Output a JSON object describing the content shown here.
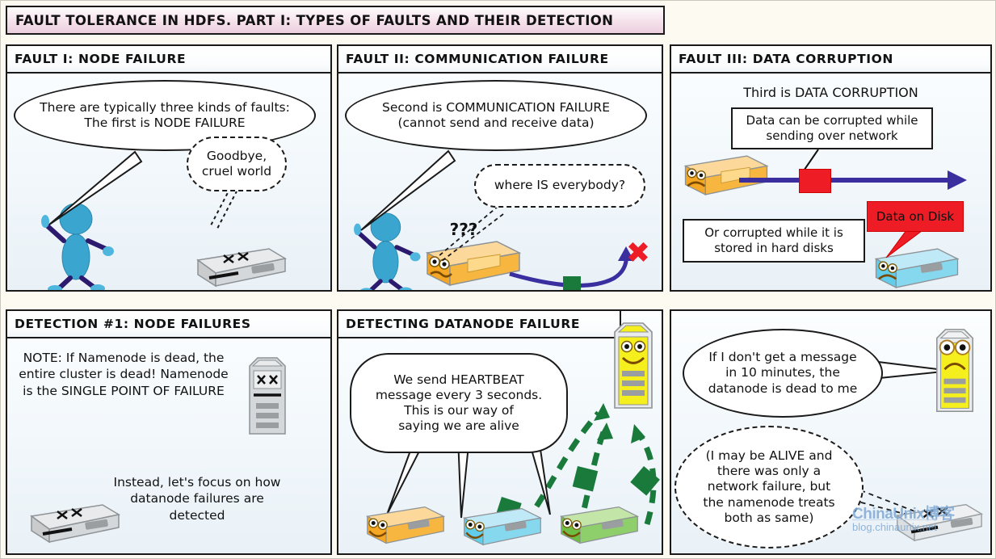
{
  "poster": {
    "title": "FAULT TOLERANCE IN HDFS. PART I: TYPES OF FAULTS AND THEIR DETECTION",
    "colors": {
      "title_bar_pink": "#eccede",
      "panel_border": "#1a1a1a",
      "page_background": "#fdfaf2",
      "panel_background": "#f4f9fc",
      "heartbeat_green": "#1a7a3c",
      "network_blue": "#3b2fa0",
      "corruption_red": "#ee1c24",
      "namenode_yellow": "#f6ef1e",
      "datanode_orange": "#f5a623",
      "datanode_cyan": "#62cdea",
      "datanode_green": "#6cbe45",
      "dead_node_gray": "#c9cbcd",
      "stick_figure_blue": "#3aa6d0",
      "watermark_blue": "#7fa9d4"
    }
  },
  "panels": [
    {
      "id": "fault-1",
      "header": "FAULT I: NODE FAILURE",
      "bubbles": [
        {
          "name": "narrator-bubble",
          "lines": [
            "There are typically three kinds of faults:",
            "The first is NODE FAILURE"
          ]
        },
        {
          "name": "dying-node-bubble",
          "lines": [
            "Goodbye,",
            "cruel world"
          ]
        }
      ],
      "figures": [
        {
          "name": "narrator-stick-figure",
          "kind": "stick-figure",
          "color": "#3aa6d0"
        },
        {
          "name": "dead-datanode",
          "kind": "server-dead",
          "color": "#c9cbcd",
          "face": "dead"
        }
      ]
    },
    {
      "id": "fault-2",
      "header": "FAULT II: COMMUNICATION FAILURE",
      "bubbles": [
        {
          "name": "narrator-bubble",
          "lines": [
            "Second is COMMUNICATION FAILURE",
            "(cannot send and receive data)"
          ]
        },
        {
          "name": "isolated-node-bubble",
          "lines": [
            "where IS everybody?"
          ]
        }
      ],
      "figures": [
        {
          "name": "narrator-stick-figure",
          "kind": "stick-figure",
          "color": "#3aa6d0"
        },
        {
          "name": "confused-datanode",
          "kind": "server",
          "color": "#f5a623",
          "face": "confused",
          "thought": "???"
        },
        {
          "name": "broken-link-arrow",
          "kind": "arrow",
          "color": "#3b2fa0",
          "marker": "green-square"
        },
        {
          "name": "failure-cross",
          "kind": "cross",
          "color": "#ee1c24",
          "label": "✖"
        }
      ]
    },
    {
      "id": "fault-3",
      "header": "FAULT III: DATA CORRUPTION",
      "caption": "Third is DATA CORRUPTION",
      "bubbles": [
        {
          "name": "network-corruption-box",
          "lines": [
            "Data can be corrupted while",
            "sending over network"
          ]
        },
        {
          "name": "disk-corruption-box",
          "lines": [
            "Or corrupted while it is",
            "stored in hard disks"
          ]
        }
      ],
      "callouts": [
        {
          "name": "data-on-disk-callout",
          "label": "Data on Disk",
          "color": "#ee1c24"
        }
      ],
      "figures": [
        {
          "name": "sending-datanode",
          "kind": "server",
          "color": "#f5a623",
          "face": "sad"
        },
        {
          "name": "corrupt-packet-block",
          "kind": "block",
          "color": "#ee1c24"
        },
        {
          "name": "network-arrow",
          "kind": "arrow",
          "color": "#3b2fa0"
        },
        {
          "name": "disk-datanode",
          "kind": "server",
          "color": "#62cdea",
          "face": "sad"
        }
      ]
    },
    {
      "id": "detection-1",
      "header": "DETECTION #1: NODE FAILURES",
      "notes": [
        {
          "name": "namenode-spof-note",
          "lines": [
            "NOTE:",
            "If Namenode is dead,",
            "the entire cluster is dead!",
            "Namenode is the SINGLE",
            "POINT OF FAILURE"
          ]
        },
        {
          "name": "focus-note",
          "lines": [
            "Instead, let's focus on",
            "how datanode failures",
            "are detected"
          ]
        }
      ],
      "figures": [
        {
          "name": "dead-namenode-tower",
          "kind": "tower-dead",
          "color": "#c9cbcd",
          "face": "dead"
        },
        {
          "name": "dead-datanode",
          "kind": "server-dead",
          "color": "#c9cbcd",
          "face": "dead"
        }
      ]
    },
    {
      "id": "detection-datanode",
      "header": "DETECTING DATANODE FAILURE",
      "bubbles": [
        {
          "name": "heartbeat-bubble",
          "lines": [
            "We send HEARTBEAT",
            "message every 3 seconds.",
            "This is our way of",
            "saying we are alive"
          ]
        }
      ],
      "figures": [
        {
          "name": "namenode-tower-happy",
          "kind": "tower",
          "color": "#f6ef1e",
          "face": "happy"
        },
        {
          "name": "datanode-orange",
          "kind": "server",
          "color": "#f5a623",
          "face": "happy"
        },
        {
          "name": "datanode-cyan",
          "kind": "server",
          "color": "#62cdea",
          "face": "happy"
        },
        {
          "name": "datanode-green",
          "kind": "server",
          "color": "#6cbe45",
          "face": "happy"
        },
        {
          "name": "heartbeat-arrow-1",
          "kind": "dashed-arrow",
          "color": "#1a7a3c"
        },
        {
          "name": "heartbeat-arrow-2",
          "kind": "dashed-arrow",
          "color": "#1a7a3c"
        },
        {
          "name": "heartbeat-arrow-3",
          "kind": "dashed-arrow",
          "color": "#1a7a3c"
        }
      ]
    },
    {
      "id": "detection-timeout",
      "header": "",
      "bubbles": [
        {
          "name": "timeout-bubble",
          "lines": [
            "If I don't get a message",
            "in 10 minutes, the",
            "datanode is dead to me"
          ]
        },
        {
          "name": "datanode-protest-bubble",
          "lines": [
            "(I may be ALIVE and",
            "there was only a",
            "network failure, but",
            "the namenode treats",
            "both as same)"
          ]
        }
      ],
      "figures": [
        {
          "name": "namenode-tower-worried",
          "kind": "tower",
          "color": "#f6ef1e",
          "face": "sad"
        },
        {
          "name": "presumed-dead-datanode",
          "kind": "server-dead",
          "color": "#c9cbcd",
          "face": "dead"
        }
      ]
    }
  ],
  "watermark": {
    "top": "ChinaUnix博客",
    "bottom": "blog.chinaunix.net"
  }
}
